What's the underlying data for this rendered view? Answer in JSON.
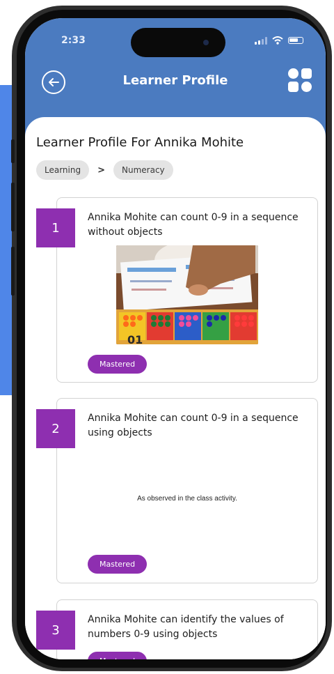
{
  "status_bar": {
    "time": "2:33"
  },
  "header": {
    "title": "Learner Profile"
  },
  "profile": {
    "heading": "Learner Profile For Annika Mohite"
  },
  "breadcrumb": {
    "items": [
      "Learning",
      "Numeracy"
    ],
    "separator": ">"
  },
  "cards": [
    {
      "number": "1",
      "text": "Annika Mohite can count 0-9 in a sequence without objects",
      "status": "Mastered"
    },
    {
      "number": "2",
      "text": "Annika Mohite can count 0-9 in a sequence using objects",
      "note": "As observed in the class activity.",
      "status": "Mastered"
    },
    {
      "number": "3",
      "text": "Annika Mohite can identify the values of numbers 0-9 using objects",
      "status": "Mastered"
    }
  ],
  "colors": {
    "header_blue": "#4b7bc0",
    "accent_purple": "#8e2fb0",
    "backdrop_blue": "#4f86e8"
  },
  "icons": {
    "back": "back-arrow-icon",
    "menu": "grid-menu-icon"
  }
}
